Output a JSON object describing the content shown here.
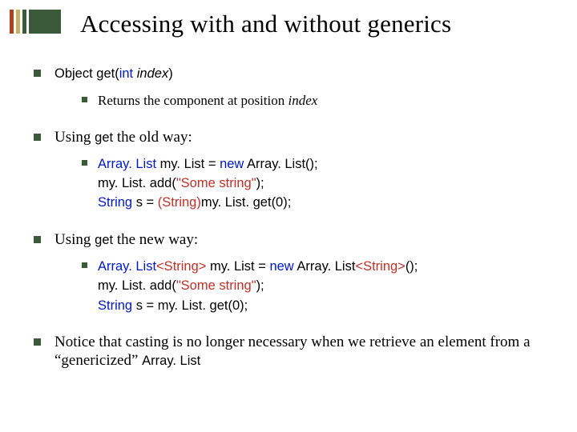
{
  "title": "Accessing with and without generics",
  "sig": {
    "ret": "Object",
    "name": "get",
    "paren_open": "(",
    "param_type": "int",
    "space": " ",
    "param_name": "index",
    "paren_close": ")"
  },
  "sig_desc": {
    "pre": "Returns the component at position ",
    "idx": "index"
  },
  "old_way": {
    "pre": "Using ",
    "fn": "get",
    "post": " the old way:"
  },
  "old_code": {
    "l1a": "Array. List",
    "l1b": " my. List = ",
    "l1c": "new",
    "l1d": " Array. List();",
    "l2": "my. List. add(",
    "l2s": "\"Some string\"",
    "l2e": ");",
    "l3a": "String",
    "l3b": " s = ",
    "l3c": "(String)",
    "l3d": "my. List. get(0);"
  },
  "new_way": {
    "pre": "Using ",
    "fn": "get",
    "post": " the new way:"
  },
  "new_code": {
    "l1a": "Array. List",
    "l1g1": "<String>",
    "l1b": " my. List = ",
    "l1c": "new",
    "l1d": " Array. List",
    "l1g2": "<String>",
    "l1e": "();",
    "l2": "my. List. add(",
    "l2s": "\"Some string\"",
    "l2e": ");",
    "l3a": "String",
    "l3b": " s = my. List. get(0);"
  },
  "note": {
    "pre": "Notice that casting is no longer necessary when we retrieve an element from a “genericized” ",
    "cls": "Array. List"
  }
}
